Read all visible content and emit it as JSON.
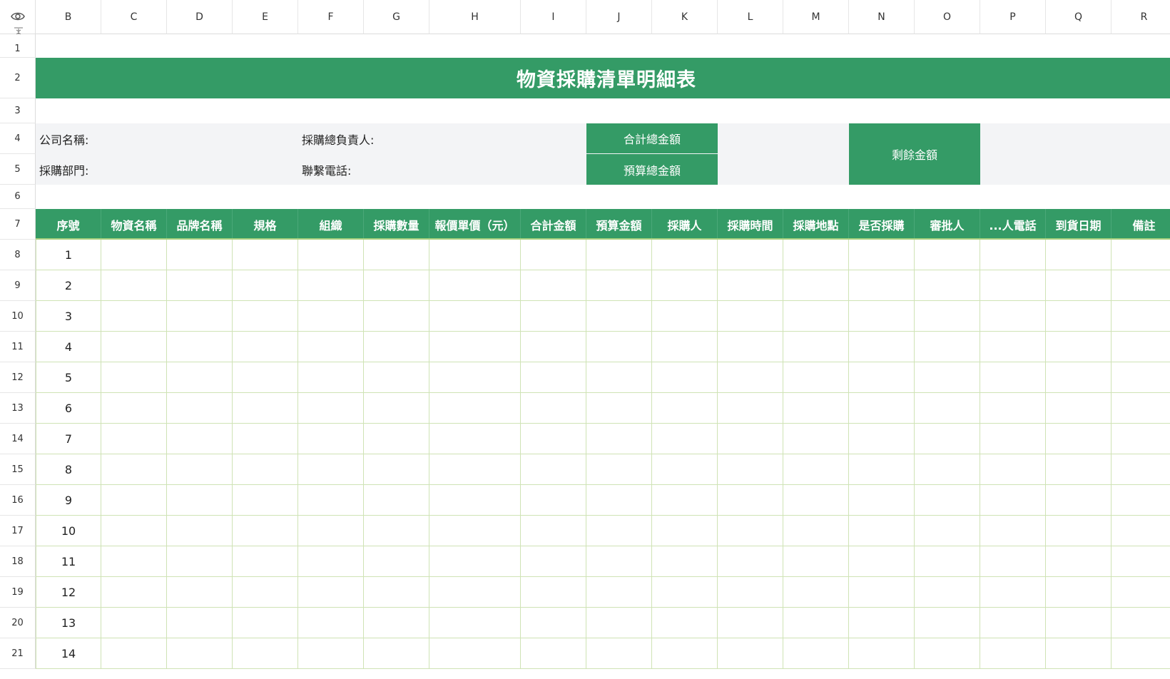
{
  "columns": [
    "B",
    "C",
    "D",
    "E",
    "F",
    "G",
    "H",
    "I",
    "J",
    "K",
    "L",
    "M",
    "N",
    "O",
    "P",
    "Q",
    "R"
  ],
  "rows": [
    "1",
    "2",
    "3",
    "4",
    "5",
    "6",
    "7",
    "8",
    "9",
    "10",
    "11",
    "12",
    "13",
    "14",
    "15",
    "16",
    "17",
    "18",
    "19",
    "20",
    "21"
  ],
  "title": "物資採購清單明細表",
  "info": {
    "company_label": "公司名稱:",
    "dept_label": "採購部門:",
    "manager_label": "採購總負責人:",
    "phone_label": "聯繫電話:",
    "total_amount": "合計總金額",
    "budget_amount": "預算總金額",
    "remaining_amount": "剩餘金額"
  },
  "table_headers": [
    "序號",
    "物資名稱",
    "品牌名稱",
    "規格",
    "組織",
    "採購數量",
    "報價單價（元）",
    "合計金額",
    "預算金額",
    "採購人",
    "採購時間",
    "採購地點",
    "是否採購",
    "審批人",
    "...人電話",
    "到貨日期",
    "備註"
  ],
  "serials": [
    "1",
    "2",
    "3",
    "4",
    "5",
    "6",
    "7",
    "8",
    "9",
    "10",
    "11",
    "12",
    "13",
    "14"
  ],
  "colors": {
    "green": "#349b66",
    "grid_green": "#cfe3b5",
    "info_bg": "#f3f4f6"
  },
  "icons": {
    "corner": "eye-icon",
    "freeze": "freeze-rows-icon"
  }
}
